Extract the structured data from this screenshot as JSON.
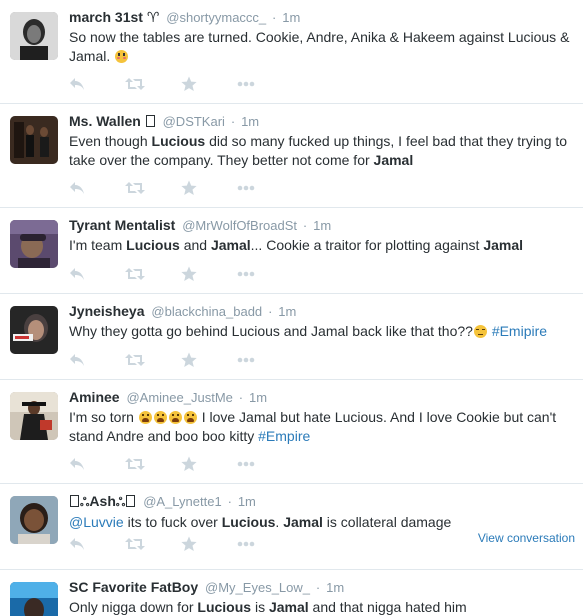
{
  "feed": {
    "view_conversation_label": "View conversation",
    "tweets": [
      {
        "name": "march 31st ♈",
        "handle": "@shortyymaccc_",
        "time": "1m",
        "text_parts": [
          "So now the tables are turned. Cookie, Andre, Anika & Hakeem against Lucious & Jamal."
        ],
        "emoji": "flushed-face"
      },
      {
        "name": "Ms. Wallen",
        "name_glyph": "□",
        "handle": "@DSTKari",
        "time": "1m",
        "text_parts": [
          "Even though ",
          "Lucious",
          " did so many fucked up things, I feel bad that they trying to take over the company. They better not come for ",
          "Jamal"
        ]
      },
      {
        "name": "Tyrant Mentalist",
        "handle": "@MrWolfOfBroadSt",
        "time": "1m",
        "text_parts": [
          "I'm team ",
          "Lucious",
          " and ",
          "Jamal",
          "... Cookie a traitor for plotting against ",
          "Jamal"
        ]
      },
      {
        "name": "Jyneisheya",
        "handle": "@blackchina_badd",
        "time": "1m",
        "text_parts": [
          "Why they gotta go behind Lucious and Jamal back like that tho??"
        ],
        "emoji": "unamused-face",
        "hashtag": "#Emipire"
      },
      {
        "name": "Aminee",
        "handle": "@Aminee_JustMe",
        "time": "1m",
        "text_parts": [
          "I'm so torn ",
          " I love Jamal but hate Lucious. And I love Cookie but can't stand Andre and boo boo kitty "
        ],
        "emoji": "weary-face",
        "emoji_count": 4,
        "hashtag": "#Empire"
      },
      {
        "name_prefix": "□",
        "name_symbol_1": "ஃ",
        "name": "Ash",
        "name_symbol_2": "ஃ",
        "name_suffix": "□",
        "handle": "@A_Lynette1",
        "time": "1m",
        "mention": "@Luvvie",
        "text_parts": [
          " its to fuck over ",
          "Lucious",
          ". ",
          "Jamal",
          " is collateral damage"
        ],
        "has_conversation": true
      },
      {
        "name": "SC Favorite FatBoy",
        "handle": "@My_Eyes_Low_",
        "time": "1m",
        "text_parts": [
          "Only nigga down for ",
          "Lucious",
          " is ",
          "Jamal",
          " and that nigga hated him"
        ]
      }
    ]
  },
  "colors": {
    "name": "#292f33",
    "meta": "#8899a6",
    "link": "#2b7bb9",
    "action_icon": "#ccd6dd",
    "divider": "#e1e8ed"
  },
  "icons": [
    "reply-icon",
    "retweet-icon",
    "favorite-icon",
    "more-icon"
  ]
}
